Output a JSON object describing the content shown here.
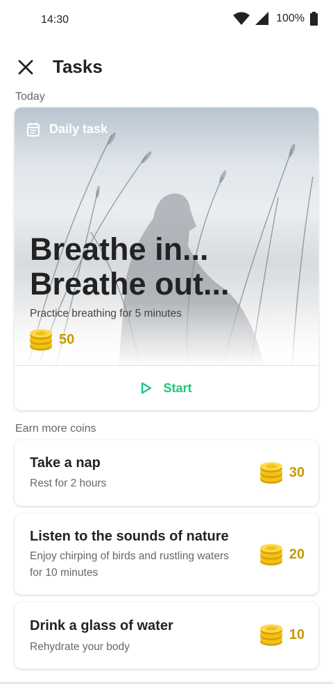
{
  "status": {
    "time": "14:30",
    "battery": "100%"
  },
  "header": {
    "title": "Tasks"
  },
  "sections": {
    "today": "Today",
    "earn_more": "Earn more coins"
  },
  "daily_task": {
    "tag": "Daily task",
    "headline": "Breathe in...\nBreathe out...",
    "description": "Practice breathing for 5 minutes",
    "coins": "50",
    "start_label": "Start"
  },
  "tasks": [
    {
      "title": "Take a nap",
      "subtitle": "Rest for 2 hours",
      "coins": "30"
    },
    {
      "title": "Listen to the sounds of nature",
      "subtitle": "Enjoy chirping of birds and rustling waters for 10 minutes",
      "coins": "20"
    },
    {
      "title": "Drink a glass of water",
      "subtitle": "Rehydrate your body",
      "coins": "10"
    }
  ],
  "colors": {
    "accent_green": "#1fc67a",
    "coin_gold": "#c69a00"
  },
  "icons": [
    "wifi-icon",
    "cell-signal-icon",
    "battery-icon",
    "close-icon",
    "calendar-icon",
    "coins-icon",
    "play-icon"
  ]
}
